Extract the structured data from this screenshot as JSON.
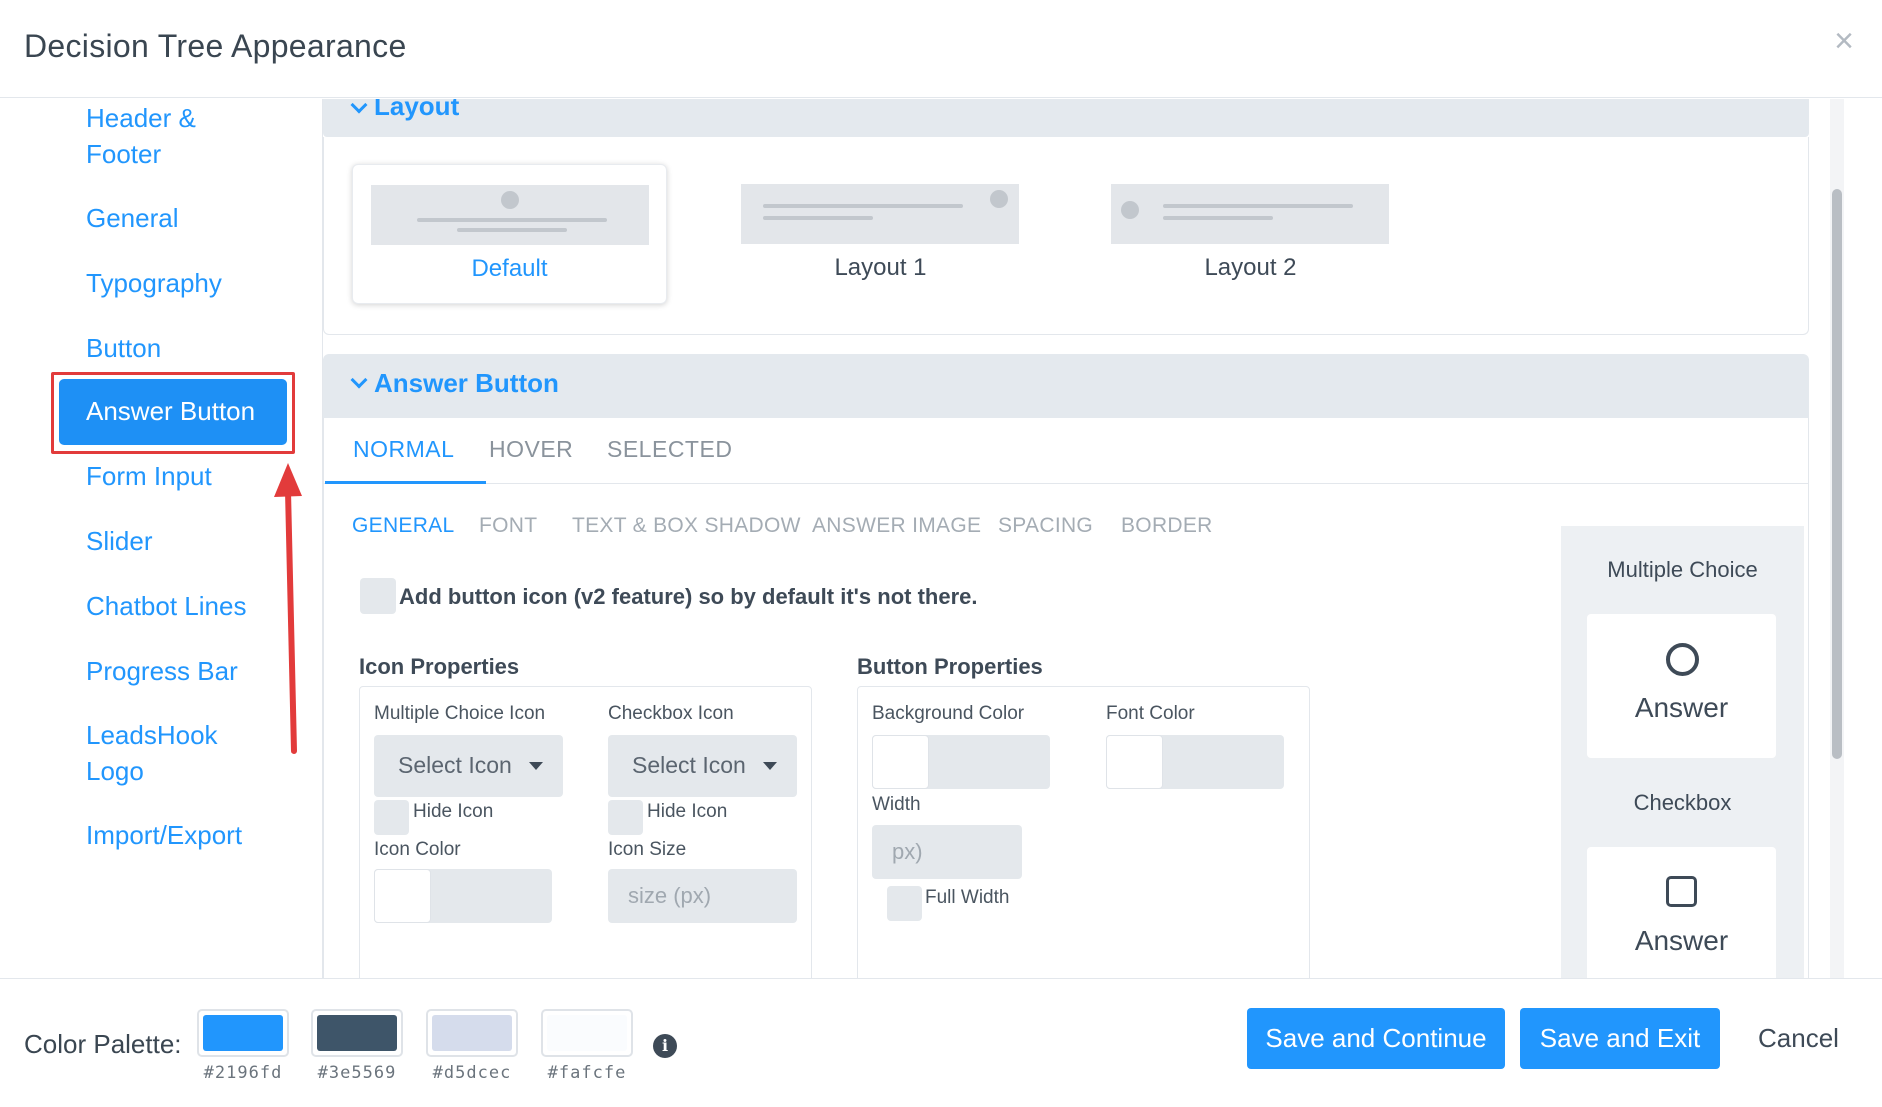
{
  "header": {
    "title": "Decision Tree Appearance",
    "close_icon": "×"
  },
  "sidebar": {
    "items": [
      {
        "label_line1": "Header &",
        "label_line2": "Footer"
      },
      {
        "label": "General"
      },
      {
        "label": "Typography"
      },
      {
        "label": "Button"
      },
      {
        "label": "Answer Button",
        "active": true
      },
      {
        "label": "Form Input"
      },
      {
        "label": "Slider"
      },
      {
        "label": "Chatbot Lines"
      },
      {
        "label": "Progress Bar"
      },
      {
        "label_line1": "LeadsHook",
        "label_line2": "Logo"
      },
      {
        "label": "Import/Export"
      }
    ]
  },
  "layout_section": {
    "title": "Layout",
    "options": [
      {
        "label": "Default",
        "selected": true
      },
      {
        "label": "Layout 1",
        "selected": false
      },
      {
        "label": "Layout 2",
        "selected": false
      }
    ]
  },
  "answer_button_section": {
    "title": "Answer Button",
    "state_tabs": [
      "NORMAL",
      "HOVER",
      "SELECTED"
    ],
    "active_state_tab": "NORMAL",
    "sub_tabs": [
      "GENERAL",
      "FONT",
      "TEXT & BOX SHADOW",
      "ANSWER IMAGE",
      "SPACING",
      "BORDER"
    ],
    "active_sub_tab": "GENERAL",
    "add_icon_label": "Add button icon (v2 feature) so by default it's not there.",
    "icon_properties": {
      "title": "Icon Properties",
      "multiple_choice_icon_label": "Multiple Choice Icon",
      "multiple_choice_icon_value": "Select Icon",
      "checkbox_icon_label": "Checkbox Icon",
      "checkbox_icon_value": "Select Icon",
      "hide_icon_label": "Hide Icon",
      "icon_color_label": "Icon Color",
      "icon_size_label": "Icon Size",
      "icon_size_placeholder": "size (px)"
    },
    "button_properties": {
      "title": "Button Properties",
      "background_color_label": "Background Color",
      "font_color_label": "Font Color",
      "width_label": "Width",
      "width_placeholder": "px)",
      "full_width_label": "Full Width"
    },
    "preview": {
      "multiple_choice_label": "Multiple Choice",
      "checkbox_label": "Checkbox",
      "answer_text": "Answer"
    }
  },
  "footer": {
    "palette_label": "Color Palette:",
    "palette": [
      {
        "hex": "#2196fd"
      },
      {
        "hex": "#3e5569"
      },
      {
        "hex": "#d5dcec"
      },
      {
        "hex": "#fafcfe"
      }
    ],
    "info_icon": "i",
    "save_continue_label": "Save and Continue",
    "save_exit_label": "Save and Exit",
    "cancel_label": "Cancel"
  },
  "colors": {
    "accent": "#2196fd",
    "annotation_red": "#e23b3b"
  }
}
